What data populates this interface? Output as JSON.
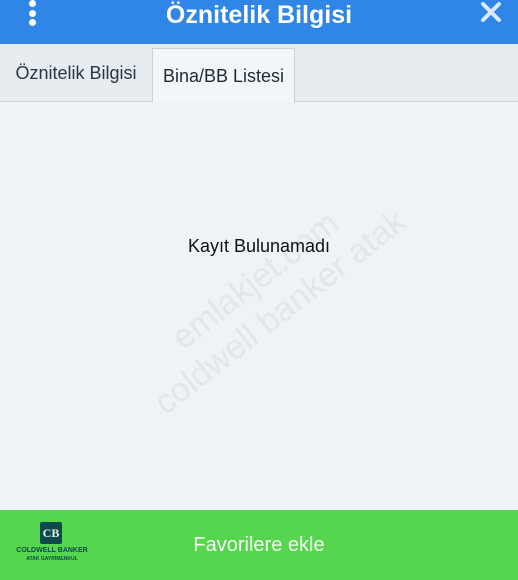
{
  "header": {
    "title": "Öznitelik Bilgisi",
    "menu_icon": "kebab-menu-icon",
    "close_icon": "close-icon",
    "color": "#2f86e6"
  },
  "tabs": [
    {
      "label": "Öznitelik Bilgisi",
      "active": false
    },
    {
      "label": "Bina/BB Listesi",
      "active": true
    }
  ],
  "content": {
    "empty_message": "Kayıt Bulunamadı"
  },
  "watermark": {
    "line1": "emlakjet.com",
    "line2": "coldwell banker atak"
  },
  "footer": {
    "color": "#56d54f",
    "button_label": "Favorilere ekle",
    "logo": {
      "mark": "CB",
      "name": "COLDWELL BANKER",
      "subtitle": "ATAK GAYRİMENKUL"
    }
  }
}
